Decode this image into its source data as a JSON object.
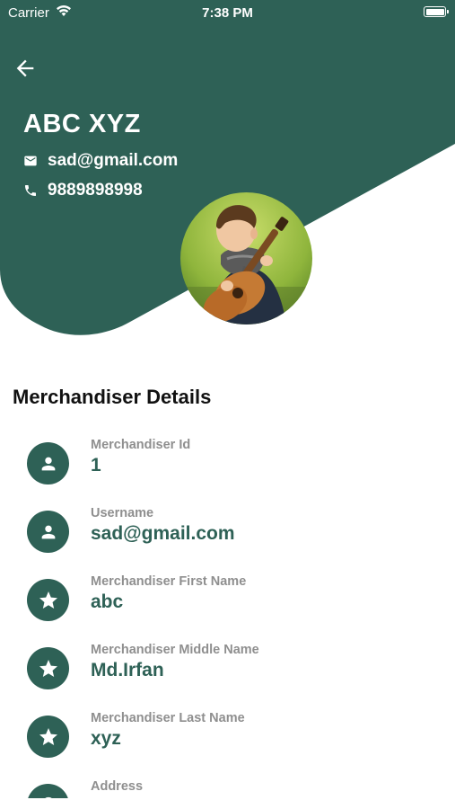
{
  "status_bar": {
    "carrier": "Carrier",
    "time": "7:38 PM"
  },
  "theme": {
    "primary": "#2e6156",
    "on_primary": "#ffffff"
  },
  "profile": {
    "name": "ABC XYZ",
    "email": "sad@gmail.com",
    "phone": "9889898998",
    "avatar": "profile-photo-child-with-guitar"
  },
  "details": {
    "title": "Merchandiser Details",
    "items": [
      {
        "label": "Merchandiser Id",
        "value": "1",
        "icon": "person-icon"
      },
      {
        "label": "Username",
        "value": "sad@gmail.com",
        "icon": "person-icon"
      },
      {
        "label": "Merchandiser First Name",
        "value": "abc",
        "icon": "star-icon"
      },
      {
        "label": "Merchandiser Middle Name",
        "value": "Md.Irfan",
        "icon": "star-icon"
      },
      {
        "label": "Merchandiser Last Name",
        "value": "xyz",
        "icon": "star-icon"
      },
      {
        "label": "Address",
        "value": "",
        "icon": "location-icon"
      }
    ]
  }
}
